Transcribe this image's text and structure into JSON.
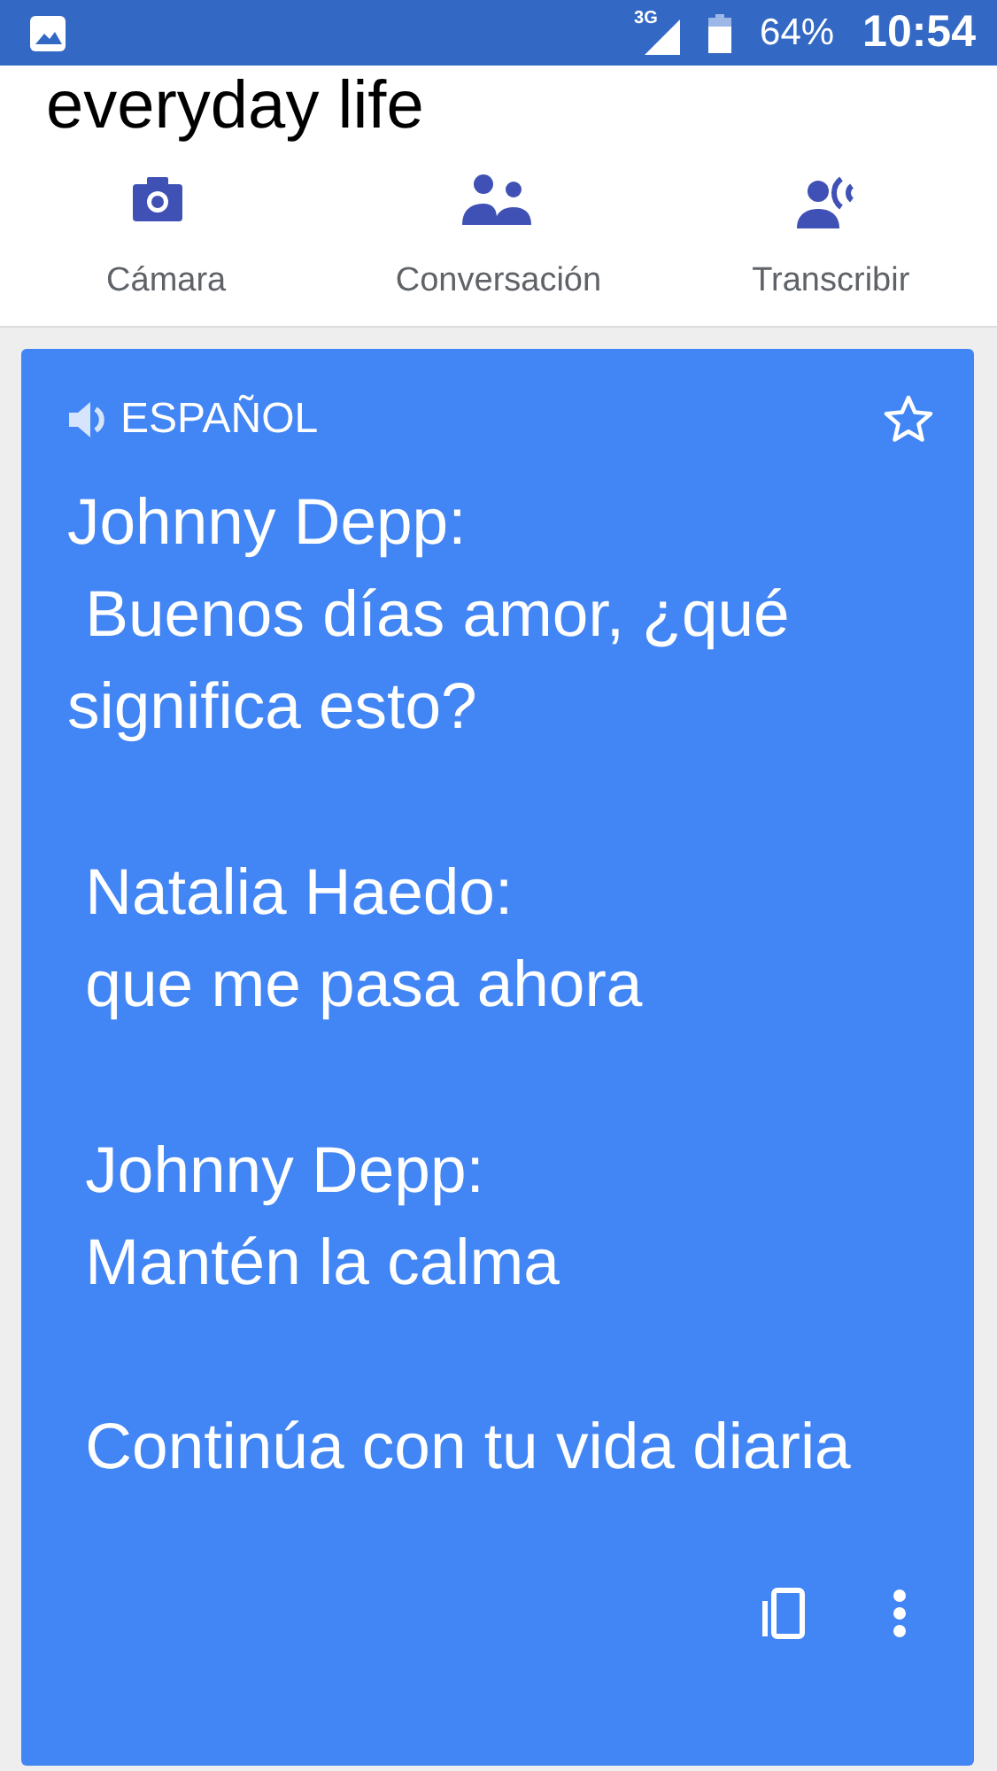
{
  "status_bar": {
    "network": "3G",
    "battery": "64%",
    "time": "10:54"
  },
  "title": "everyday life",
  "modes": [
    {
      "kind": "camera",
      "label": "Cámara"
    },
    {
      "kind": "conversation",
      "label": "Conversación"
    },
    {
      "kind": "transcribe",
      "label": "Transcribir"
    }
  ],
  "translation_card": {
    "language": "ESPAÑOL",
    "starred": false,
    "text": "Johnny Depp:\n Buenos días amor, ¿qué significa esto?\n\n Natalia Haedo:\n que me pasa ahora\n\n Johnny Depp:\n Mantén la calma\n\n Continúa con tu vida diaria"
  }
}
